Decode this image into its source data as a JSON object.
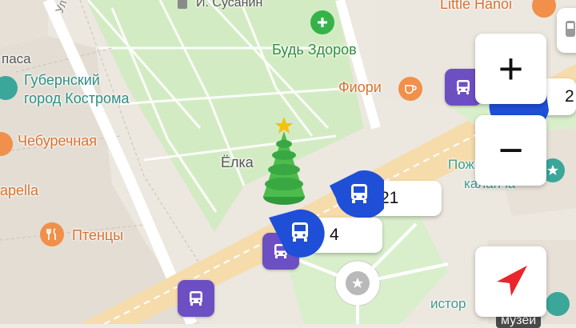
{
  "map": {
    "labels": {
      "susanin": "И. Сусанин",
      "street_fragment": "Ул",
      "pasa": "паса",
      "gubernsky": "Губернский",
      "gubernsky2": "город Кострома",
      "cheburechnaya": "Чебуречная",
      "apella": "apella",
      "ptentsy": "Птенцы",
      "bud_zdorov": "Будь Здоров",
      "fiori": "Фиори",
      "little_hanoi": "Little Hanoi",
      "yolka": "Ёлка",
      "poj1": "Пож",
      "poj2": "каланча",
      "istor": "истор",
      "muzei": "музеи"
    },
    "routes": [
      {
        "number": "21"
      },
      {
        "number": "4"
      },
      {
        "number": "2"
      }
    ]
  },
  "controls": {
    "zoom_in": "+",
    "zoom_out": "−"
  },
  "colors": {
    "park": "#d4ecc4",
    "road": "#ffffff",
    "main_road": "#f3d9a6",
    "stop": "#6d4fc4",
    "route_pin": "#1f4fd6",
    "poi_orange": "#f0904a",
    "poi_teal": "#3aa79a",
    "pharmacy": "#35b34a"
  }
}
